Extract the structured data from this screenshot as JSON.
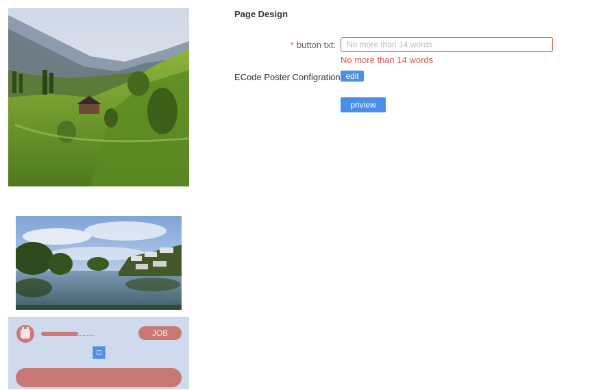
{
  "page": {
    "title": "Page Design"
  },
  "form": {
    "button_txt": {
      "required_mark": "*",
      "label": "button txt:",
      "value": "",
      "placeholder": "No more than 14 words",
      "error": "No more than 14 words"
    },
    "poster_config": {
      "label": "ECode Poster Configration",
      "edit_label": "edit"
    },
    "preview_label": "priview"
  },
  "phone_preview": {
    "job_button_label": "JOB"
  },
  "colors": {
    "primary": "#4a8fe7",
    "error": "#d9534f",
    "theme_rose": "#c97775",
    "panel_blue": "#cfdbec"
  }
}
